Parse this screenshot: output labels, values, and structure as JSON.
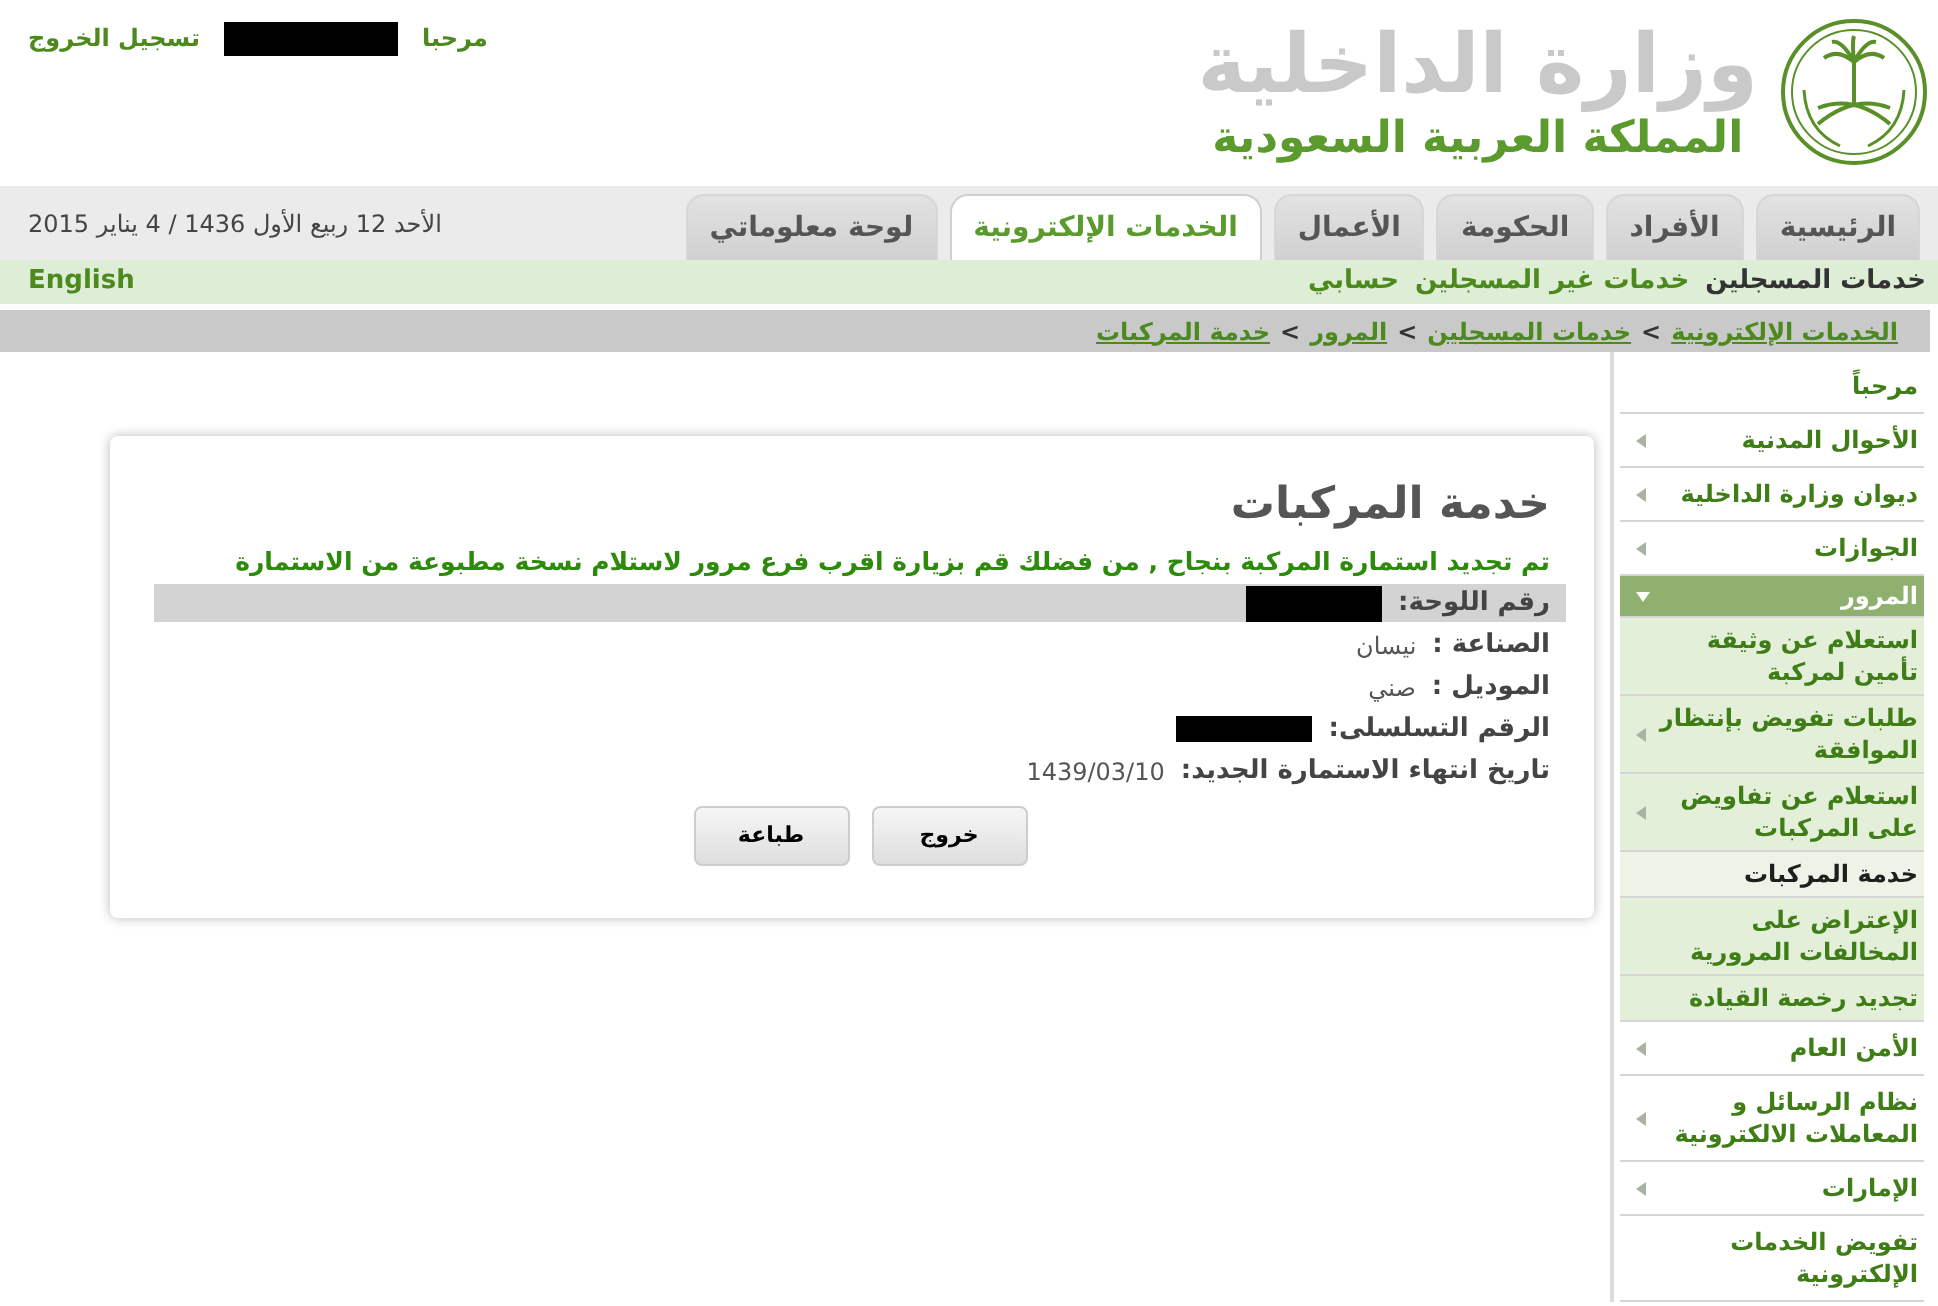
{
  "header": {
    "greeting": "مرحبا",
    "user_redacted": true,
    "logout": "تسجيل الخروج",
    "title": "وزارة الداخلية",
    "subtitle": "المملكة العربية السعودية"
  },
  "tabs": [
    {
      "label": "الرئيسية",
      "selected": false
    },
    {
      "label": "الأفراد",
      "selected": false
    },
    {
      "label": "الحكومة",
      "selected": false
    },
    {
      "label": "الأعمال",
      "selected": false
    },
    {
      "label": "الخدمات الإلكترونية",
      "selected": true
    },
    {
      "label": "لوحة معلوماتي",
      "selected": false
    }
  ],
  "date": "الأحد 12 ربيع الأول 1436 / 4 يناير 2015",
  "subnav": {
    "items": [
      {
        "label": "خدمات المسجلين",
        "selected": true
      },
      {
        "label": "خدمات غير المسجلين",
        "selected": false
      },
      {
        "label": "حسابي",
        "selected": false
      }
    ],
    "language": "English"
  },
  "breadcrumb": [
    {
      "kind": "link",
      "label": "الخدمات الإلكترونية"
    },
    {
      "kind": "separator",
      "label": ">"
    },
    {
      "kind": "link",
      "label": "خدمات المسجلين"
    },
    {
      "kind": "separator",
      "label": ">"
    },
    {
      "kind": "link",
      "label": "المرور"
    },
    {
      "kind": "separator",
      "label": ">"
    },
    {
      "kind": "link",
      "label": "خدمة المركبات"
    }
  ],
  "sidebar": {
    "items": [
      {
        "label": "مرحباً",
        "kind": "link"
      },
      {
        "label": "الأحوال المدنية",
        "kind": "submenu",
        "expanded": false
      },
      {
        "label": "ديوان وزارة الداخلية",
        "kind": "submenu",
        "expanded": false
      },
      {
        "label": "الجوازات",
        "kind": "submenu",
        "expanded": false
      },
      {
        "label": "المرور",
        "kind": "submenu",
        "expanded": true,
        "children": [
          {
            "label": "استعلام عن وثيقة تأمين لمركبة",
            "kind": "link",
            "selected": false
          },
          {
            "label": "طلبات تفويض بإنتظار الموافقة",
            "kind": "submenu",
            "expanded": false,
            "selected": false
          },
          {
            "label": "استعلام عن تفاويض على المركبات",
            "kind": "submenu",
            "expanded": false,
            "selected": false
          },
          {
            "label": "خدمة المركبات",
            "kind": "link",
            "selected": true
          },
          {
            "label": "الإعتراض على المخالفات المرورية",
            "kind": "link",
            "selected": false
          },
          {
            "label": "تجديد رخصة القيادة",
            "kind": "link",
            "selected": false
          }
        ]
      },
      {
        "label": "الأمن العام",
        "kind": "submenu",
        "expanded": false
      },
      {
        "label": "نظام الرسائل و المعاملات الالكترونية",
        "kind": "submenu",
        "expanded": false
      },
      {
        "label": "الإمارات",
        "kind": "submenu",
        "expanded": false
      },
      {
        "label": "تفويض الخدمات الإلكترونية",
        "kind": "link"
      }
    ]
  },
  "card": {
    "title": "خدمة المركبات",
    "message": "تم تجديد استمارة المركبة بنجاح , من فضلك قم بزيارة اقرب فرع مرور لاستلام نسخة مطبوعة من الاستمارة",
    "fields": [
      {
        "label": "رقم اللوحة:",
        "redacted": true,
        "highlighted": true
      },
      {
        "label": "الصناعة :",
        "value": "نيسان",
        "redacted": false,
        "highlighted": false
      },
      {
        "label": "الموديل :",
        "value": "صني",
        "redacted": false,
        "highlighted": false
      },
      {
        "label": "الرقم التسلسلى:",
        "redacted": true,
        "highlighted": false
      },
      {
        "label": "تاريخ انتهاء الاستمارة الجديد:",
        "value": "1439/03/10",
        "redacted": false,
        "highlighted": false
      }
    ],
    "buttons": [
      "خروج",
      "طباعة"
    ]
  }
}
